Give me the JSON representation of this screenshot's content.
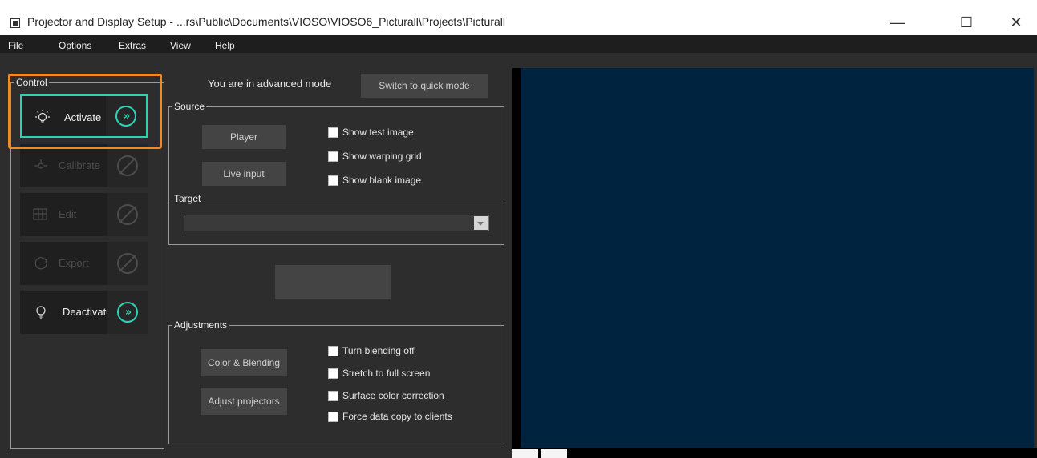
{
  "window": {
    "title": "Projector and Display Setup - ...rs\\Public\\Documents\\VIOSO\\VIOSO6_Picturall\\Projects\\Picturall",
    "controls": {
      "minimize": "—",
      "maximize": "☐",
      "close": "✕"
    }
  },
  "menu": [
    "File",
    "Options",
    "Extras",
    "View",
    "Help"
  ],
  "control_group": {
    "label": "Control",
    "activate": "Activate",
    "calibrate": "Calibrate",
    "edit": "Edit",
    "export": "Export",
    "deactivate": "Deactivate",
    "go_glyph": "»"
  },
  "mode": {
    "text": "You are in advanced mode",
    "switch_button": "Switch to quick mode"
  },
  "source": {
    "label": "Source",
    "player_button": "Player",
    "live_input_button": "Live input",
    "show_test_image": "Show test image",
    "show_warping_grid": "Show warping grid",
    "show_blank_image": "Show blank image"
  },
  "target": {
    "label": "Target",
    "selected": ""
  },
  "adjustments": {
    "label": "Adjustments",
    "color_blending_button": "Color & Blending",
    "adjust_projectors_button": "Adjust projectors",
    "turn_blending_off": "Turn blending off",
    "stretch_full_screen": "Stretch to full screen",
    "surface_color_correction": "Surface color correction",
    "force_data_copy": "Force data copy to clients"
  },
  "colors": {
    "accent": "#2ad3b8",
    "highlight": "#f08a24",
    "preview_bg": "#00243f"
  }
}
